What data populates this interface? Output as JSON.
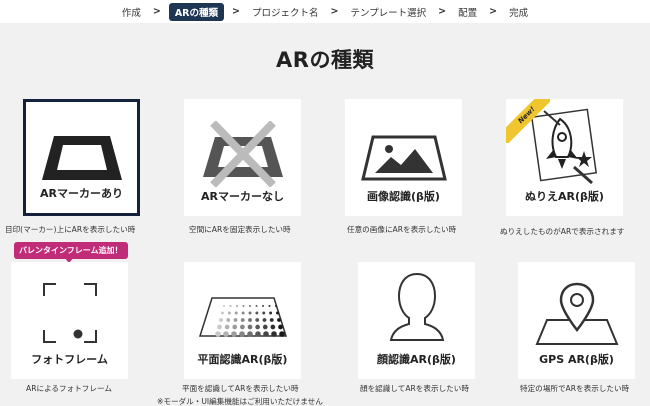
{
  "breadcrumb": {
    "items": [
      "作成",
      "ARの種類",
      "プロジェクト名",
      "テンプレート選択",
      "配置",
      "完成"
    ],
    "separator": ">"
  },
  "title": "ARの種類",
  "promo": "バレンタインフレーム追加！",
  "new_badge": "New!",
  "cards": [
    {
      "label": "ARマーカーあり",
      "desc": "目印(マーカー)上にARを表示したい時",
      "icon": "marker-frame-icon",
      "selected": true
    },
    {
      "label": "ARマーカーなし",
      "desc": "空間にARを固定表示したい時",
      "icon": "no-marker-icon"
    },
    {
      "label": "画像認識(β版)",
      "desc": "任意の画像にARを表示したい時",
      "icon": "image-landscape-icon"
    },
    {
      "label": "ぬりえAR(β版)",
      "desc": "ぬりえしたものがARで表示されます",
      "icon": "coloring-rocket-icon"
    },
    {
      "label": "フォトフレーム",
      "desc": "ARによるフォトフレーム",
      "icon": "photo-frame-icon"
    },
    {
      "label": "平面認識AR(β版)",
      "desc": "平面を認識してARを表示したい時",
      "desc2": "※モーダル・UI編集機能はご利用いただけません",
      "icon": "plane-dots-icon"
    },
    {
      "label": "顔認識AR(β版)",
      "desc": "顔を認識してARを表示したい時",
      "icon": "face-silhouette-icon"
    },
    {
      "label": "GPS AR(β版)",
      "desc": "特定の場所でARを表示したい時",
      "icon": "map-pin-icon"
    }
  ],
  "colors": {
    "selected_border": "#13223a",
    "active_crumb": "#1f3554",
    "promo": "#c12c79",
    "new": "#f0c630"
  }
}
